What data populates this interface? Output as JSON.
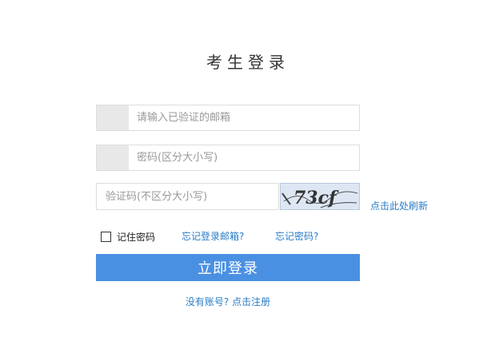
{
  "page": {
    "title": "考生登录"
  },
  "form": {
    "email_placeholder": "请输入已验证的邮箱",
    "password_placeholder": "密码(区分大小写)",
    "captcha_placeholder": "验证码(不区分大小写)",
    "captcha_text": "73cf",
    "refresh_label": "点击此处刷新",
    "remember_label": "记住密码",
    "forgot_email_label": "忘记登录邮箱?",
    "forgot_password_label": "忘记密码?",
    "login_label": "立即登录",
    "register_label": "没有账号? 点击注册"
  },
  "colors": {
    "accent": "#4a90e2",
    "link": "#2a7cc7",
    "icon_cell": "#e8e8e8"
  }
}
